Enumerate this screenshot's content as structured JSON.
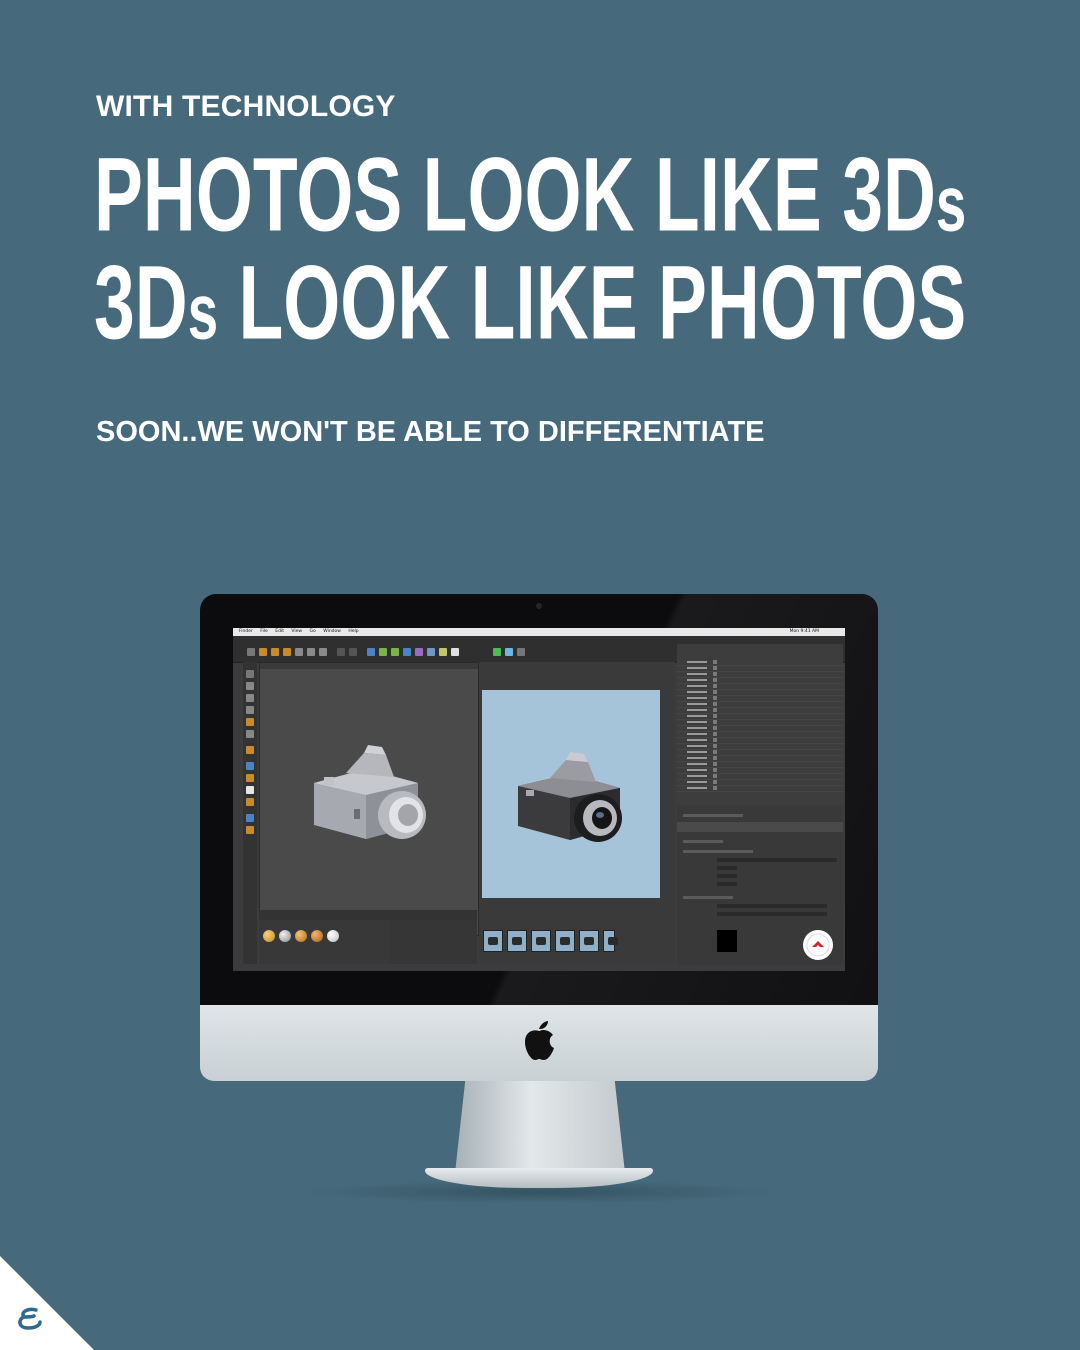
{
  "eyebrow": "WITH TECHNOLOGY",
  "headline": {
    "line1_main": "PHOTOS LOOK LIKE 3D",
    "line1_suffix": "s",
    "line2_prefix": "3D",
    "line2_suffix": "s",
    "line2_rest": " LOOK LIKE PHOTOS"
  },
  "tagline": "SOON..WE WON'T BE ABLE TO DIFFERENTIATE",
  "screen": {
    "menu_items": [
      "Finder",
      "File",
      "Edit",
      "View",
      "Go",
      "Window",
      "Help"
    ],
    "clock": "Mon 9:41 AM"
  },
  "icons": {
    "monitor_logo": "apple-logo-icon",
    "render_badge": "cinema4d-logo-icon",
    "corner_brand": "brand-logo-icon"
  },
  "colors": {
    "background": "#466a7c",
    "text": "#ffffff",
    "render_view": "#a5c3d9"
  }
}
